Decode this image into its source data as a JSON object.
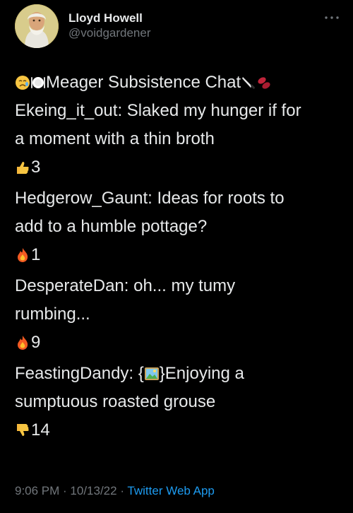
{
  "author": {
    "display_name": "Lloyd Howell",
    "handle": "@voidgardener"
  },
  "tweet": {
    "title": "Meager Subsistence Chat",
    "title_icons": [
      "sad-face-icon",
      "plate-icon",
      "knife-icon",
      "beans-icon"
    ],
    "messages": [
      {
        "line1": "Ekeing_it_out: Slaked my hunger if for",
        "line2": "a moment with a thin broth",
        "reaction_icon": "thumbs-up-icon",
        "count": "3"
      },
      {
        "line1": "Hedgerow_Gaunt: Ideas for roots to",
        "line2": "add to a humble pottage?",
        "reaction_icon": "fire-icon",
        "count": "1"
      },
      {
        "line1": "DesperateDan: oh... my tumy",
        "line2": "rumbing...",
        "reaction_icon": "fire-icon",
        "count": "9"
      },
      {
        "line1_pre": "FeastingDandy: {",
        "line1_post": "}Enjoying a",
        "line2": "sumptuous roasted grouse",
        "inline_icon": "framed-picture-icon",
        "reaction_icon": "thumbs-down-icon",
        "count": "14"
      }
    ]
  },
  "footer": {
    "time": "9:06 PM",
    "separator1": " · ",
    "date": "10/13/22",
    "separator2": " · ",
    "source": "Twitter Web App"
  },
  "colors": {
    "background": "#000000",
    "text": "#e7e9ea",
    "muted": "#71767b",
    "link": "#1d9bf0"
  }
}
